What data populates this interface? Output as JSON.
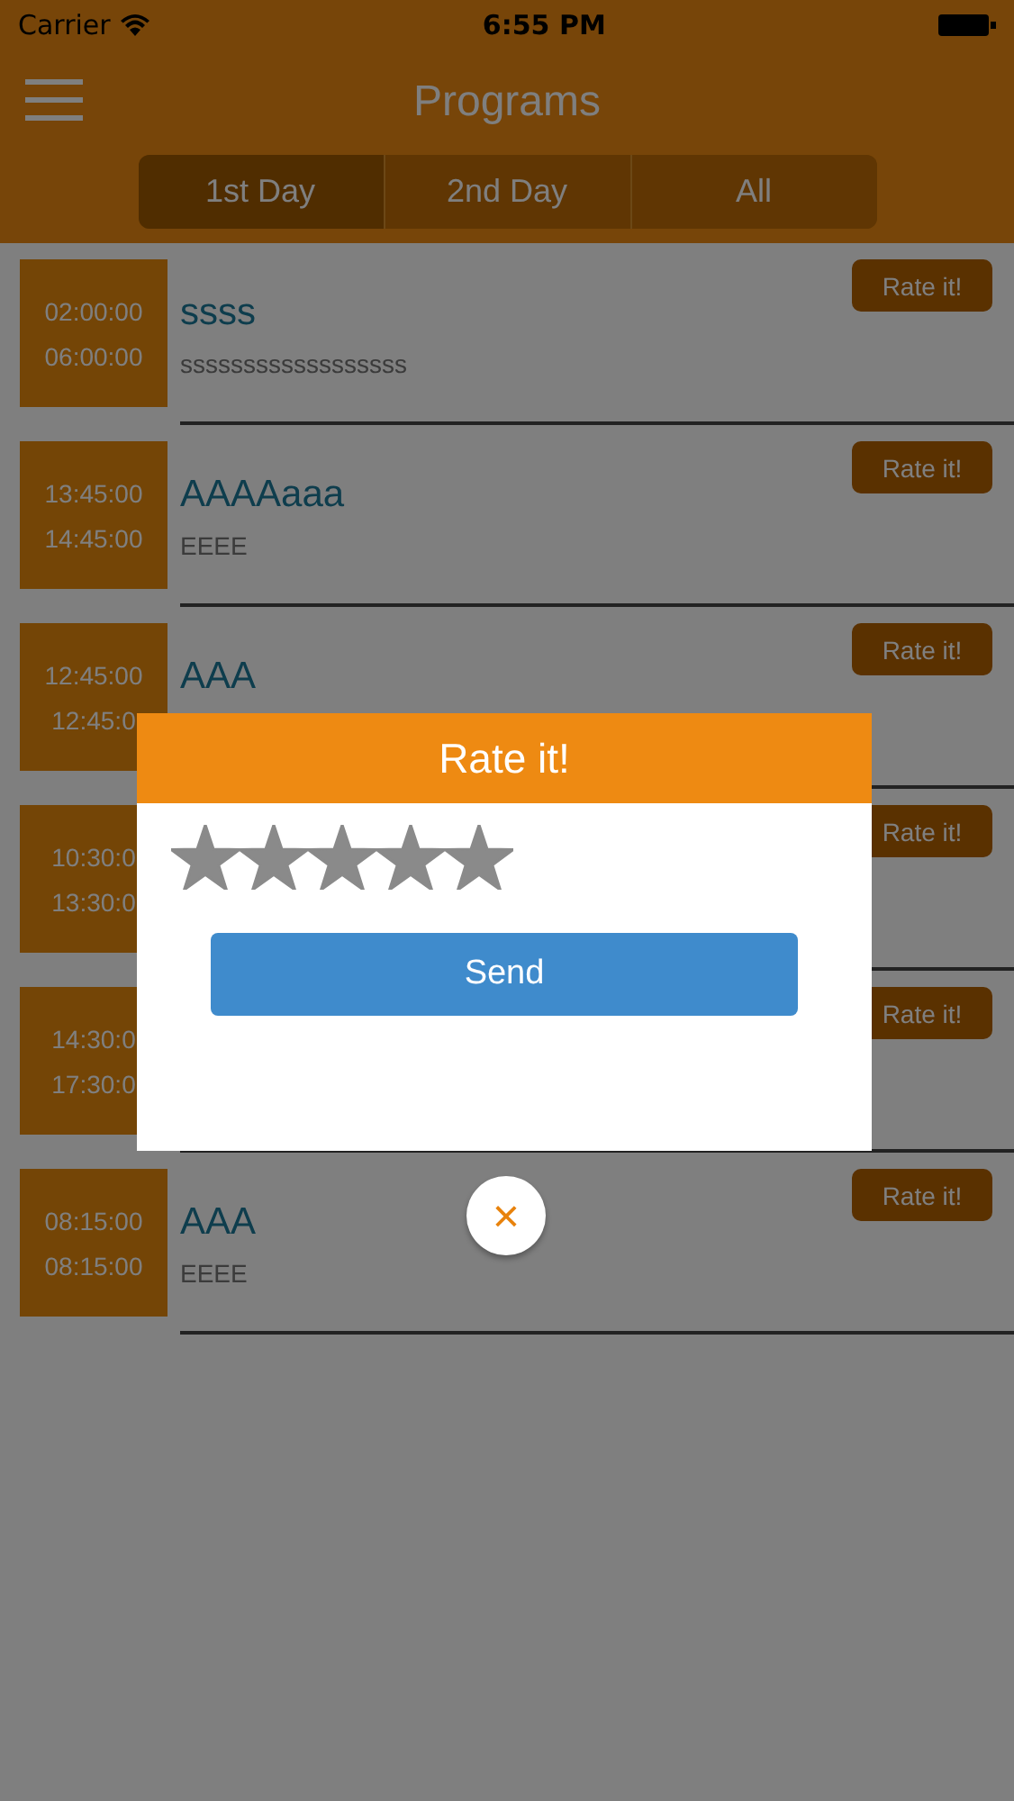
{
  "status_bar": {
    "carrier": "Carrier",
    "time": "6:55 PM"
  },
  "nav": {
    "title": "Programs"
  },
  "tabs": [
    {
      "label": "1st Day",
      "selected": true
    },
    {
      "label": "2nd Day",
      "selected": false
    },
    {
      "label": "All",
      "selected": false
    }
  ],
  "programs": [
    {
      "start": "02:00:00",
      "end": "06:00:00",
      "title": "ssss",
      "subtitle": "ssssssssssssssssss",
      "button": "Rate it!"
    },
    {
      "start": "13:45:00",
      "end": "14:45:00",
      "title": "AAAAaaa",
      "subtitle": "EEEE",
      "button": "Rate it!"
    },
    {
      "start": "12:45:00",
      "end": "12:45:0",
      "title": "AAA",
      "button": "Rate it!"
    },
    {
      "start": "10:30:0",
      "end": "13:30:0",
      "button": "Rate it!"
    },
    {
      "start": "14:30:0",
      "end": "17:30:0",
      "button": "Rate it!"
    },
    {
      "start": "08:15:00",
      "end": "08:15:00",
      "title": "AAA",
      "subtitle": "EEEE",
      "button": "Rate it!"
    }
  ],
  "dialog": {
    "title": "Rate it!",
    "stars": 5,
    "send": "Send",
    "close": "×"
  }
}
